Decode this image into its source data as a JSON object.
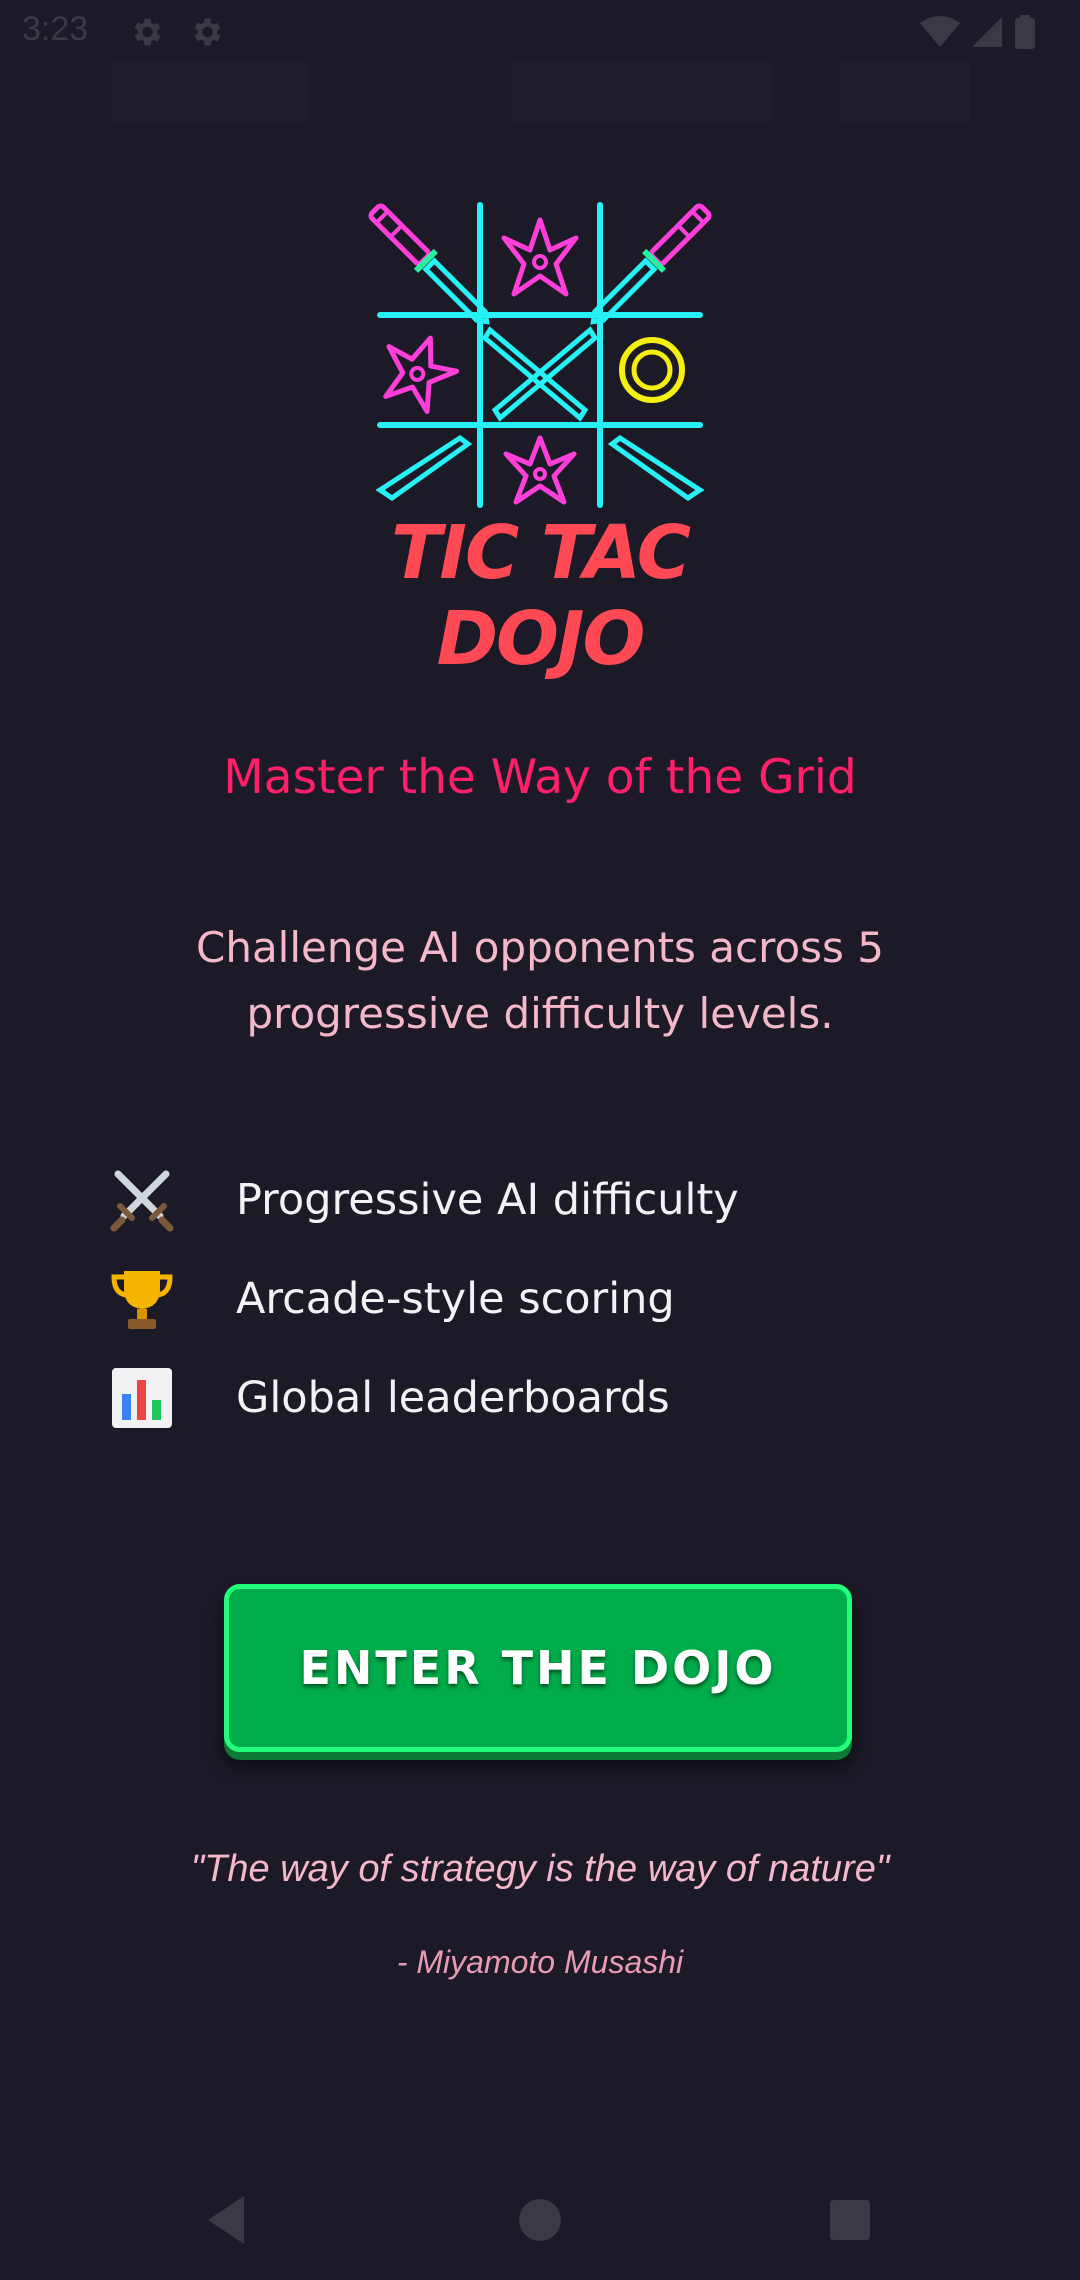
{
  "status_bar": {
    "time": "3:23",
    "icons": [
      "settings-icon",
      "settings-icon",
      "wifi-icon",
      "cellular-signal-icon",
      "battery-icon"
    ]
  },
  "logo": {
    "title": "TIC TAC DOJO",
    "colors": {
      "grid": "#27f1f5",
      "shuriken": "#ff3fd9",
      "o_mark": "#f5ee12",
      "title": "#ff4a56"
    },
    "icons": [
      "katana-icon",
      "shuriken-icon",
      "x-mark-icon",
      "o-mark-icon"
    ]
  },
  "tagline": "Master the Way of the Grid",
  "description": "Challenge AI opponents across 5 progressive difficulty levels.",
  "features": [
    {
      "icon": "crossed-swords-icon",
      "label": "Progressive AI difficulty"
    },
    {
      "icon": "trophy-icon",
      "label": "Arcade-style scoring"
    },
    {
      "icon": "bar-chart-icon",
      "label": "Global leaderboards"
    }
  ],
  "cta": {
    "label": "ENTER THE DOJO",
    "color": "#00ad4a",
    "border_color": "#22ff7a"
  },
  "quote": {
    "text": "\"The way of strategy is the way of nature\"",
    "author": "- Miyamoto Musashi"
  },
  "nav_bar": {
    "buttons": [
      "back-icon",
      "home-icon",
      "recents-icon"
    ]
  },
  "theme": {
    "background": "#1b1a26",
    "accent": "#ff1f6b"
  }
}
